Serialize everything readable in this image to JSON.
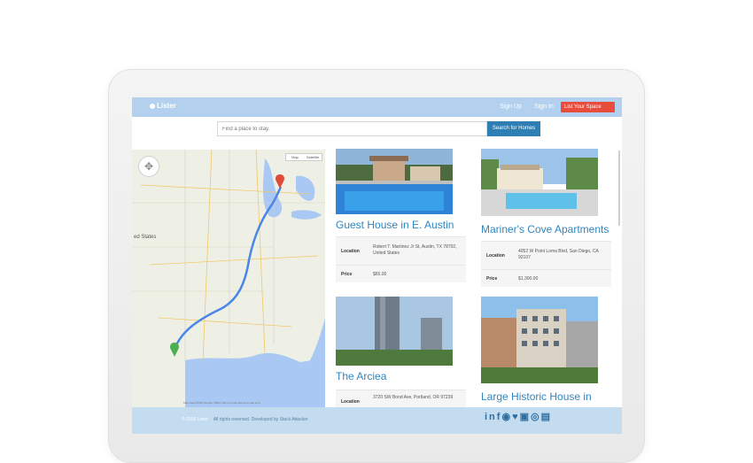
{
  "app": {
    "logo_text": "Lister",
    "nav": {
      "sign_up": "Sign Up",
      "sign_in": "Sign In",
      "list_space": "List Your Space"
    }
  },
  "search": {
    "placeholder": "Find a place to stay.",
    "button_label": "Search for Homes"
  },
  "map": {
    "view_toggle": [
      "Map",
      "Satellite"
    ],
    "region_label": "ed States",
    "attribution": "Map data ©2016 Google, INEGI   Terms of Use   Report a map error",
    "route_color": "#4a86e8"
  },
  "listings": [
    {
      "title": "Guest House in E. Austin",
      "location": "Robert T. Martinez Jr St, Austin, TX 78702, United States",
      "price": "$65.00"
    },
    {
      "title": "Mariner's Cove Apartments",
      "location": "4052 W Point Loma Blvd, San Diego, CA 92107",
      "price": "$1,300.00"
    },
    {
      "title": "The Arciea",
      "location": "3720 SW Bond Ave, Portland, OR 97239"
    },
    {
      "title": "Large Historic House in"
    }
  ],
  "labels": {
    "location": "Location",
    "price": "Price"
  },
  "footer": {
    "brand": "© 2016 Lister",
    "text": "All rights reserved. Developed by Stack Attacker"
  },
  "social_icons": [
    "linkedin-icon",
    "facebook-icon",
    "github-icon",
    "twitter-icon",
    "youtube-icon",
    "instagram-icon",
    "google-plus-icon"
  ],
  "colors": {
    "header": "#b3d1ee",
    "accent": "#2e86c1",
    "cta": "#e74c3c",
    "footer": "#c4dcf0"
  }
}
